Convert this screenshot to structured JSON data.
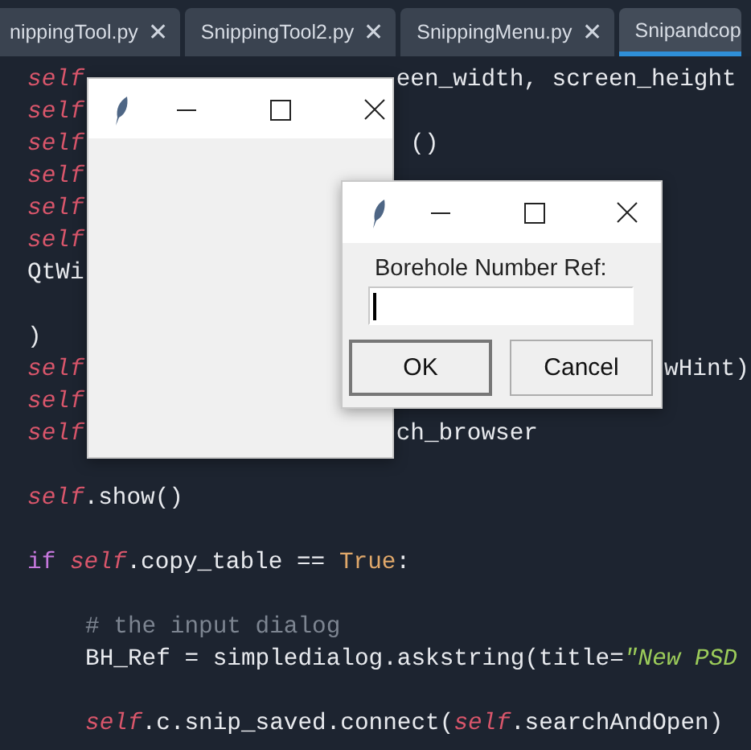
{
  "tabs": [
    {
      "label": "nippingTool.py",
      "close": "✕",
      "selected": false
    },
    {
      "label": "SnippingTool2.py",
      "close": "✕",
      "selected": false
    },
    {
      "label": "SnippingMenu.py",
      "close": "✕",
      "selected": false
    },
    {
      "label": "Snipandcop",
      "selected": true
    }
  ],
  "code_lines": [
    {
      "kind": "code",
      "left": [
        {
          "kind": "self",
          "text": "self"
        }
      ],
      "right": [
        {
          "kind": "plain",
          "text": "een_width, screen_height"
        }
      ]
    },
    {
      "kind": "code",
      "left": [
        {
          "kind": "self",
          "text": "self"
        }
      ]
    },
    {
      "kind": "code",
      "left": [
        {
          "kind": "self",
          "text": "self"
        }
      ],
      "right": [
        {
          "kind": "plain",
          "text": "()"
        }
      ]
    },
    {
      "kind": "code",
      "left": [
        {
          "kind": "self",
          "text": "self"
        }
      ]
    },
    {
      "kind": "code",
      "left": [
        {
          "kind": "self",
          "text": "self"
        }
      ]
    },
    {
      "kind": "code",
      "left": [
        {
          "kind": "self",
          "text": "self"
        }
      ]
    },
    {
      "kind": "code",
      "left": [
        {
          "kind": "plain",
          "text": "QtWi"
        }
      ]
    },
    {
      "kind": "blank"
    },
    {
      "kind": "code",
      "left": [
        {
          "kind": "plain",
          "text": ")"
        }
      ]
    },
    {
      "kind": "code",
      "left": [
        {
          "kind": "self",
          "text": "self"
        }
      ],
      "right": [
        {
          "kind": "plain",
          "text": "wHint)"
        }
      ]
    },
    {
      "kind": "code",
      "left": [
        {
          "kind": "self",
          "text": "self"
        }
      ]
    },
    {
      "kind": "code",
      "left": [
        {
          "kind": "self",
          "text": "self"
        }
      ],
      "right": [
        {
          "kind": "plain",
          "text": "ch_browser"
        }
      ]
    },
    {
      "kind": "blank"
    },
    {
      "kind": "code",
      "left": [
        {
          "kind": "self",
          "text": "self"
        },
        {
          "kind": "plain",
          "text": ".show()"
        }
      ]
    },
    {
      "kind": "blank"
    },
    {
      "kind": "code",
      "left": [
        {
          "kind": "keyword",
          "text": "if "
        },
        {
          "kind": "self",
          "text": "self"
        },
        {
          "kind": "plain",
          "text": ".copy_table == "
        },
        {
          "kind": "const",
          "text": "True"
        },
        {
          "kind": "plain",
          "text": ":"
        }
      ]
    },
    {
      "kind": "blank"
    },
    {
      "kind": "code",
      "indented": true,
      "left": [
        {
          "kind": "comment",
          "text": "# the input dialog"
        }
      ]
    },
    {
      "kind": "code",
      "indented": true,
      "left": [
        {
          "kind": "plain",
          "text": "BH_Ref = simpledialog.askstring(title="
        },
        {
          "kind": "string",
          "text": "\"New PSD"
        }
      ]
    },
    {
      "kind": "blank"
    },
    {
      "kind": "code",
      "indented": true,
      "left": [
        {
          "kind": "self",
          "text": "self"
        },
        {
          "kind": "plain",
          "text": ".c.snip_saved.connect("
        },
        {
          "kind": "self",
          "text": "self"
        },
        {
          "kind": "plain",
          "text": ".searchAndOpen)"
        }
      ]
    }
  ],
  "windows": [
    {
      "kind": "blank"
    },
    {
      "kind": "dialog",
      "prompt": "Borehole Number Ref:",
      "buttons": [
        {
          "label": "OK",
          "default": true
        },
        {
          "label": "Cancel",
          "default": false
        }
      ]
    }
  ]
}
